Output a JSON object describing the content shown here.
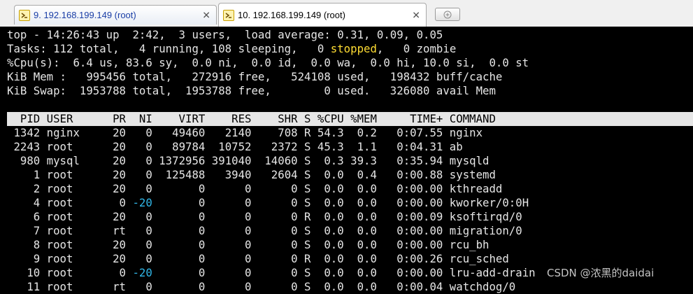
{
  "tabs": [
    {
      "label": "9. 192.168.199.149 (root)",
      "close": "✕"
    },
    {
      "label": "10. 192.168.199.149 (root)",
      "close": "✕"
    }
  ],
  "terminal": {
    "summary": {
      "top_line": "top - 14:26:43 up  2:42,  3 users,  load average: 0.31, 0.09, 0.05",
      "tasks_pre": "Tasks: 112 total,   4 running, 108 sleeping,   0 ",
      "tasks_stopped": "stopped",
      "tasks_post": ",   0 zombie",
      "cpu_line": "%Cpu(s):  6.4 us, 83.6 sy,  0.0 ni,  0.0 id,  0.0 wa,  0.0 hi, 10.0 si,  0.0 st",
      "mem_line": "KiB Mem :   995456 total,   272916 free,   524108 used,   198432 buff/cache",
      "swap_line": "KiB Swap:  1953788 total,  1953788 free,        0 used.   326080 avail Mem"
    },
    "columns": [
      "PID",
      "USER",
      "PR",
      "NI",
      "VIRT",
      "RES",
      "SHR",
      "S",
      "%CPU",
      "%MEM",
      "TIME+",
      "COMMAND"
    ],
    "header_line": "  PID USER      PR  NI    VIRT    RES    SHR S %CPU %MEM     TIME+ COMMAND",
    "processes": [
      {
        "pid": "1342",
        "user": "nginx",
        "pr": "20",
        "ni": "0",
        "virt": "49460",
        "res": "2140",
        "shr": "708",
        "s": "R",
        "cpu": "54.3",
        "mem": "0.2",
        "time": "0:07.55",
        "command": "nginx"
      },
      {
        "pid": "2243",
        "user": "root",
        "pr": "20",
        "ni": "0",
        "virt": "89784",
        "res": "10752",
        "shr": "2372",
        "s": "S",
        "cpu": "45.3",
        "mem": "1.1",
        "time": "0:04.31",
        "command": "ab"
      },
      {
        "pid": "980",
        "user": "mysql",
        "pr": "20",
        "ni": "0",
        "virt": "1372956",
        "res": "391040",
        "shr": "14060",
        "s": "S",
        "cpu": "0.3",
        "mem": "39.3",
        "time": "0:35.94",
        "command": "mysqld"
      },
      {
        "pid": "1",
        "user": "root",
        "pr": "20",
        "ni": "0",
        "virt": "125488",
        "res": "3940",
        "shr": "2604",
        "s": "S",
        "cpu": "0.0",
        "mem": "0.4",
        "time": "0:00.88",
        "command": "systemd"
      },
      {
        "pid": "2",
        "user": "root",
        "pr": "20",
        "ni": "0",
        "virt": "0",
        "res": "0",
        "shr": "0",
        "s": "S",
        "cpu": "0.0",
        "mem": "0.0",
        "time": "0:00.00",
        "command": "kthreadd"
      },
      {
        "pid": "4",
        "user": "root",
        "pr": "0",
        "ni": "-20",
        "virt": "0",
        "res": "0",
        "shr": "0",
        "s": "S",
        "cpu": "0.0",
        "mem": "0.0",
        "time": "0:00.00",
        "command": "kworker/0:0H"
      },
      {
        "pid": "6",
        "user": "root",
        "pr": "20",
        "ni": "0",
        "virt": "0",
        "res": "0",
        "shr": "0",
        "s": "R",
        "cpu": "0.0",
        "mem": "0.0",
        "time": "0:00.09",
        "command": "ksoftirqd/0"
      },
      {
        "pid": "7",
        "user": "root",
        "pr": "rt",
        "ni": "0",
        "virt": "0",
        "res": "0",
        "shr": "0",
        "s": "S",
        "cpu": "0.0",
        "mem": "0.0",
        "time": "0:00.00",
        "command": "migration/0"
      },
      {
        "pid": "8",
        "user": "root",
        "pr": "20",
        "ni": "0",
        "virt": "0",
        "res": "0",
        "shr": "0",
        "s": "S",
        "cpu": "0.0",
        "mem": "0.0",
        "time": "0:00.00",
        "command": "rcu_bh"
      },
      {
        "pid": "9",
        "user": "root",
        "pr": "20",
        "ni": "0",
        "virt": "0",
        "res": "0",
        "shr": "0",
        "s": "R",
        "cpu": "0.0",
        "mem": "0.0",
        "time": "0:00.26",
        "command": "rcu_sched"
      },
      {
        "pid": "10",
        "user": "root",
        "pr": "0",
        "ni": "-20",
        "virt": "0",
        "res": "0",
        "shr": "0",
        "s": "S",
        "cpu": "0.0",
        "mem": "0.0",
        "time": "0:00.00",
        "command": "lru-add-drain"
      },
      {
        "pid": "11",
        "user": "root",
        "pr": "rt",
        "ni": "0",
        "virt": "0",
        "res": "0",
        "shr": "0",
        "s": "S",
        "cpu": "0.0",
        "mem": "0.0",
        "time": "0:00.04",
        "command": "watchdog/0"
      }
    ]
  },
  "watermark": "CSDN @浓黑的daidai",
  "colors": {
    "background": "#000000",
    "foreground": "#e6e6e6",
    "header_bg": "#e6e6e6",
    "stopped": "#ffdd33",
    "negative_nice": "#31b7e8"
  }
}
